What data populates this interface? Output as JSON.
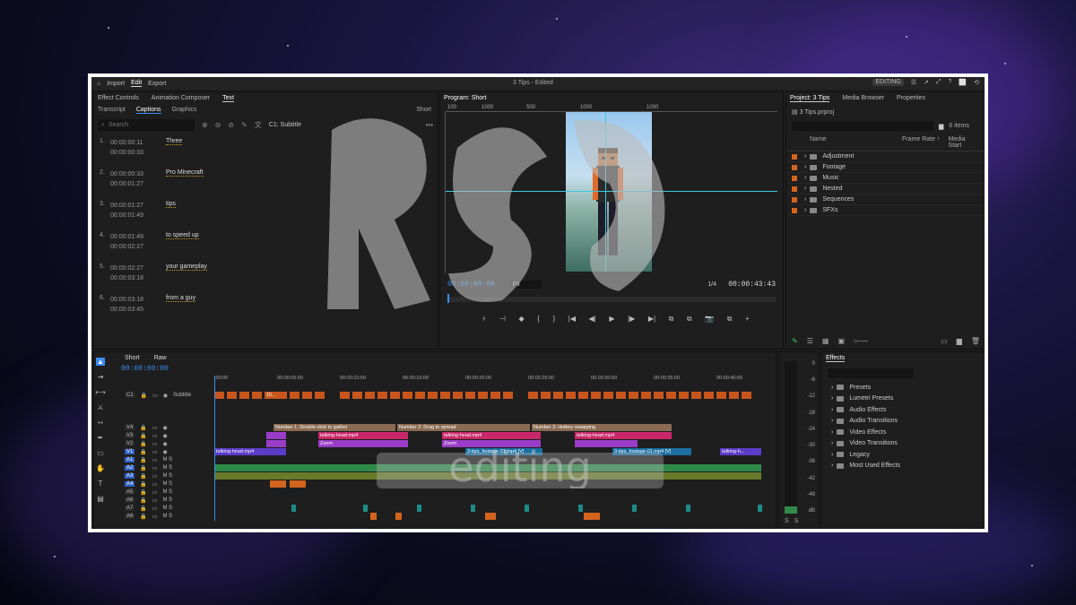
{
  "menu": {
    "home": "⌂",
    "import": "Import",
    "edit": "Edit",
    "export": "Export"
  },
  "doc_title": "3 Tips - Edited",
  "top_right": {
    "workspace": "EDITING",
    "icons": [
      "☰",
      "↗",
      "⤢"
    ],
    "window": [
      "?",
      "⬜",
      "⟲"
    ]
  },
  "text_panel": {
    "tabs": [
      "Effect Controls",
      "Animation Composer",
      "Text"
    ],
    "subtabs": [
      "Transcript",
      "Captions",
      "Graphics"
    ],
    "sequence": "Short",
    "search_placeholder": "Search",
    "track_label": "C1: Subtitle",
    "captions": [
      {
        "num": "1.",
        "in": "00:00:00:11",
        "out": "00:00:00:33",
        "text": "Three"
      },
      {
        "num": "2.",
        "in": "00:00:00:33",
        "out": "00:00:01:27",
        "text": "Pro Minecraft"
      },
      {
        "num": "3.",
        "in": "00:00:01:27",
        "out": "00:00:01:49",
        "text": "tips"
      },
      {
        "num": "4.",
        "in": "00:00:01:49",
        "out": "00:00:02:27",
        "text": "to speed up"
      },
      {
        "num": "5.",
        "in": "00:00:02:27",
        "out": "00:00:03:18",
        "text": "your gameplay"
      },
      {
        "num": "6.",
        "in": "00:00:03:18",
        "out": "00:00:03:45",
        "text": "from a guy"
      }
    ]
  },
  "program": {
    "title": "Program: Short",
    "ruler": [
      "100",
      "1000",
      "500",
      "1000",
      "1000"
    ],
    "timecode_in": "00:00:00:00",
    "fit": "Fit",
    "quality": "1/4",
    "timecode_out": "00:00:43:43",
    "transport": [
      "⊦",
      "⊣",
      "◆",
      "{",
      "}",
      "|◀",
      "◀|",
      "▶",
      "|▶",
      "▶|",
      "⧉",
      "⧉",
      "📷",
      "⧉",
      "+"
    ]
  },
  "project": {
    "tabs": [
      "Project: 3 Tips",
      "Media Browser",
      "Properties"
    ],
    "file": "3 Tips.prproj",
    "count": "6 items",
    "columns": [
      "Name",
      "Frame Rate ↑",
      "Media Start"
    ],
    "bins": [
      "Adjustment",
      "Footage",
      "Music",
      "Nested",
      "Sequences",
      "SFXs"
    ]
  },
  "timeline": {
    "tabs": [
      "Short",
      "Raw"
    ],
    "timecode": "00:00:00:00",
    "ruler": [
      ":00:00",
      "00:00:05:00",
      "00:00:10:00",
      "00:00:15:00",
      "00:00:20:00",
      "00:00:25:00",
      "00:00:30:00",
      "00:00:35:00",
      "00:00:40:00"
    ],
    "tracks": [
      "C1",
      "V4",
      "V3",
      "V2",
      "V1",
      "A1",
      "A2",
      "A3",
      "A4",
      "A5",
      "A6",
      "A7",
      "A8"
    ],
    "caption_track_name": "Subtitle",
    "clips": {
      "v4_1": "Number 1: Double-click to gather",
      "v4_2": "Number 2: Drag to spread",
      "v4_3": "Number 3: Hotkey swapping",
      "v3_1": "talking-head.mp4",
      "v3_2": "talking-head.mp4",
      "v3_3": "talking-head.mp4",
      "v2_1": "Zoom",
      "v2_2": "Zoom",
      "v1_1": "talking-head.mp4",
      "v1_2": "3-tips_footage-01.mp4 [V]",
      "v1_3": "3-tips_footage-01.mp4 [V]",
      "v1_4": "talking-h...",
      "c1_1": "15..."
    }
  },
  "meters": {
    "scale": [
      "0",
      "-6",
      "-12",
      "-18",
      "-24",
      "-30",
      "-36",
      "-42",
      "-48",
      "dB"
    ],
    "footer": [
      "S",
      "S"
    ]
  },
  "effects": {
    "title": "Effects",
    "items": [
      "Presets",
      "Lumetri Presets",
      "Audio Effects",
      "Audio Transitions",
      "Video Effects",
      "Video Transitions",
      "Legacy",
      "Most Used Effects"
    ]
  },
  "watermark": {
    "letters": "R$Ω",
    "word": "editing"
  },
  "colors": {
    "accent": "#3b8df0",
    "caption": "#c8561c",
    "title_clip": "#8a6a52",
    "pink": "#c8286a",
    "purple": "#9a3cc8",
    "teal": "#1e8a8a",
    "green_audio": "#2f8a4a",
    "orange_audio": "#d2641e"
  }
}
